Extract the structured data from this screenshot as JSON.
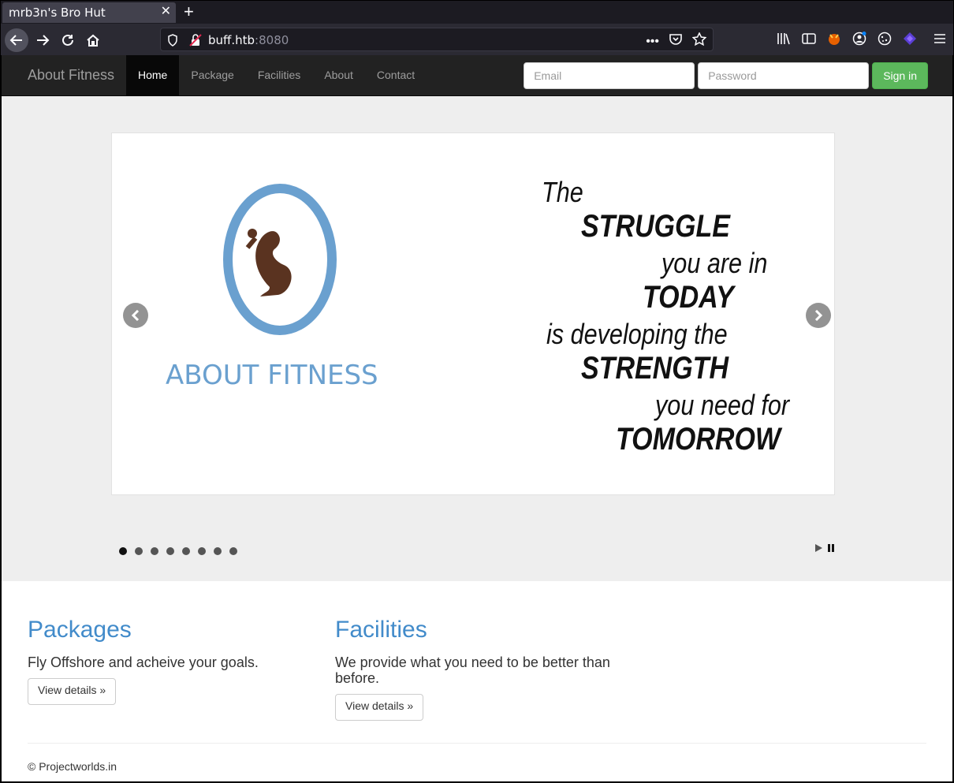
{
  "browser": {
    "tab_title": "mrb3n's Bro Hut",
    "url_host": "buff.htb",
    "url_port": ":8080"
  },
  "site": {
    "brand": "About Fitness",
    "nav": [
      "Home",
      "Package",
      "Facilities",
      "About",
      "Contact"
    ],
    "active_nav": "Home",
    "email_placeholder": "Email",
    "password_placeholder": "Password",
    "signin_label": "Sign in",
    "accent_green": "#5cb85c",
    "link_blue": "#428bca"
  },
  "carousel": {
    "logo_text": "ABOUT FITNESS",
    "quote": [
      "The",
      "STRUGGLE",
      "you are in",
      "TODAY",
      "is developing the",
      "STRENGTH",
      "you need for",
      "TOMORROW"
    ],
    "dot_count": 8,
    "active_dot": 1
  },
  "sections": [
    {
      "title": "Packages",
      "text": "Fly Offshore and acheive your goals.",
      "button": "View details »"
    },
    {
      "title": "Facilities",
      "text": "We provide what you need to be better than before.",
      "button": "View details »"
    }
  ],
  "footer": "© Projectworlds.in"
}
